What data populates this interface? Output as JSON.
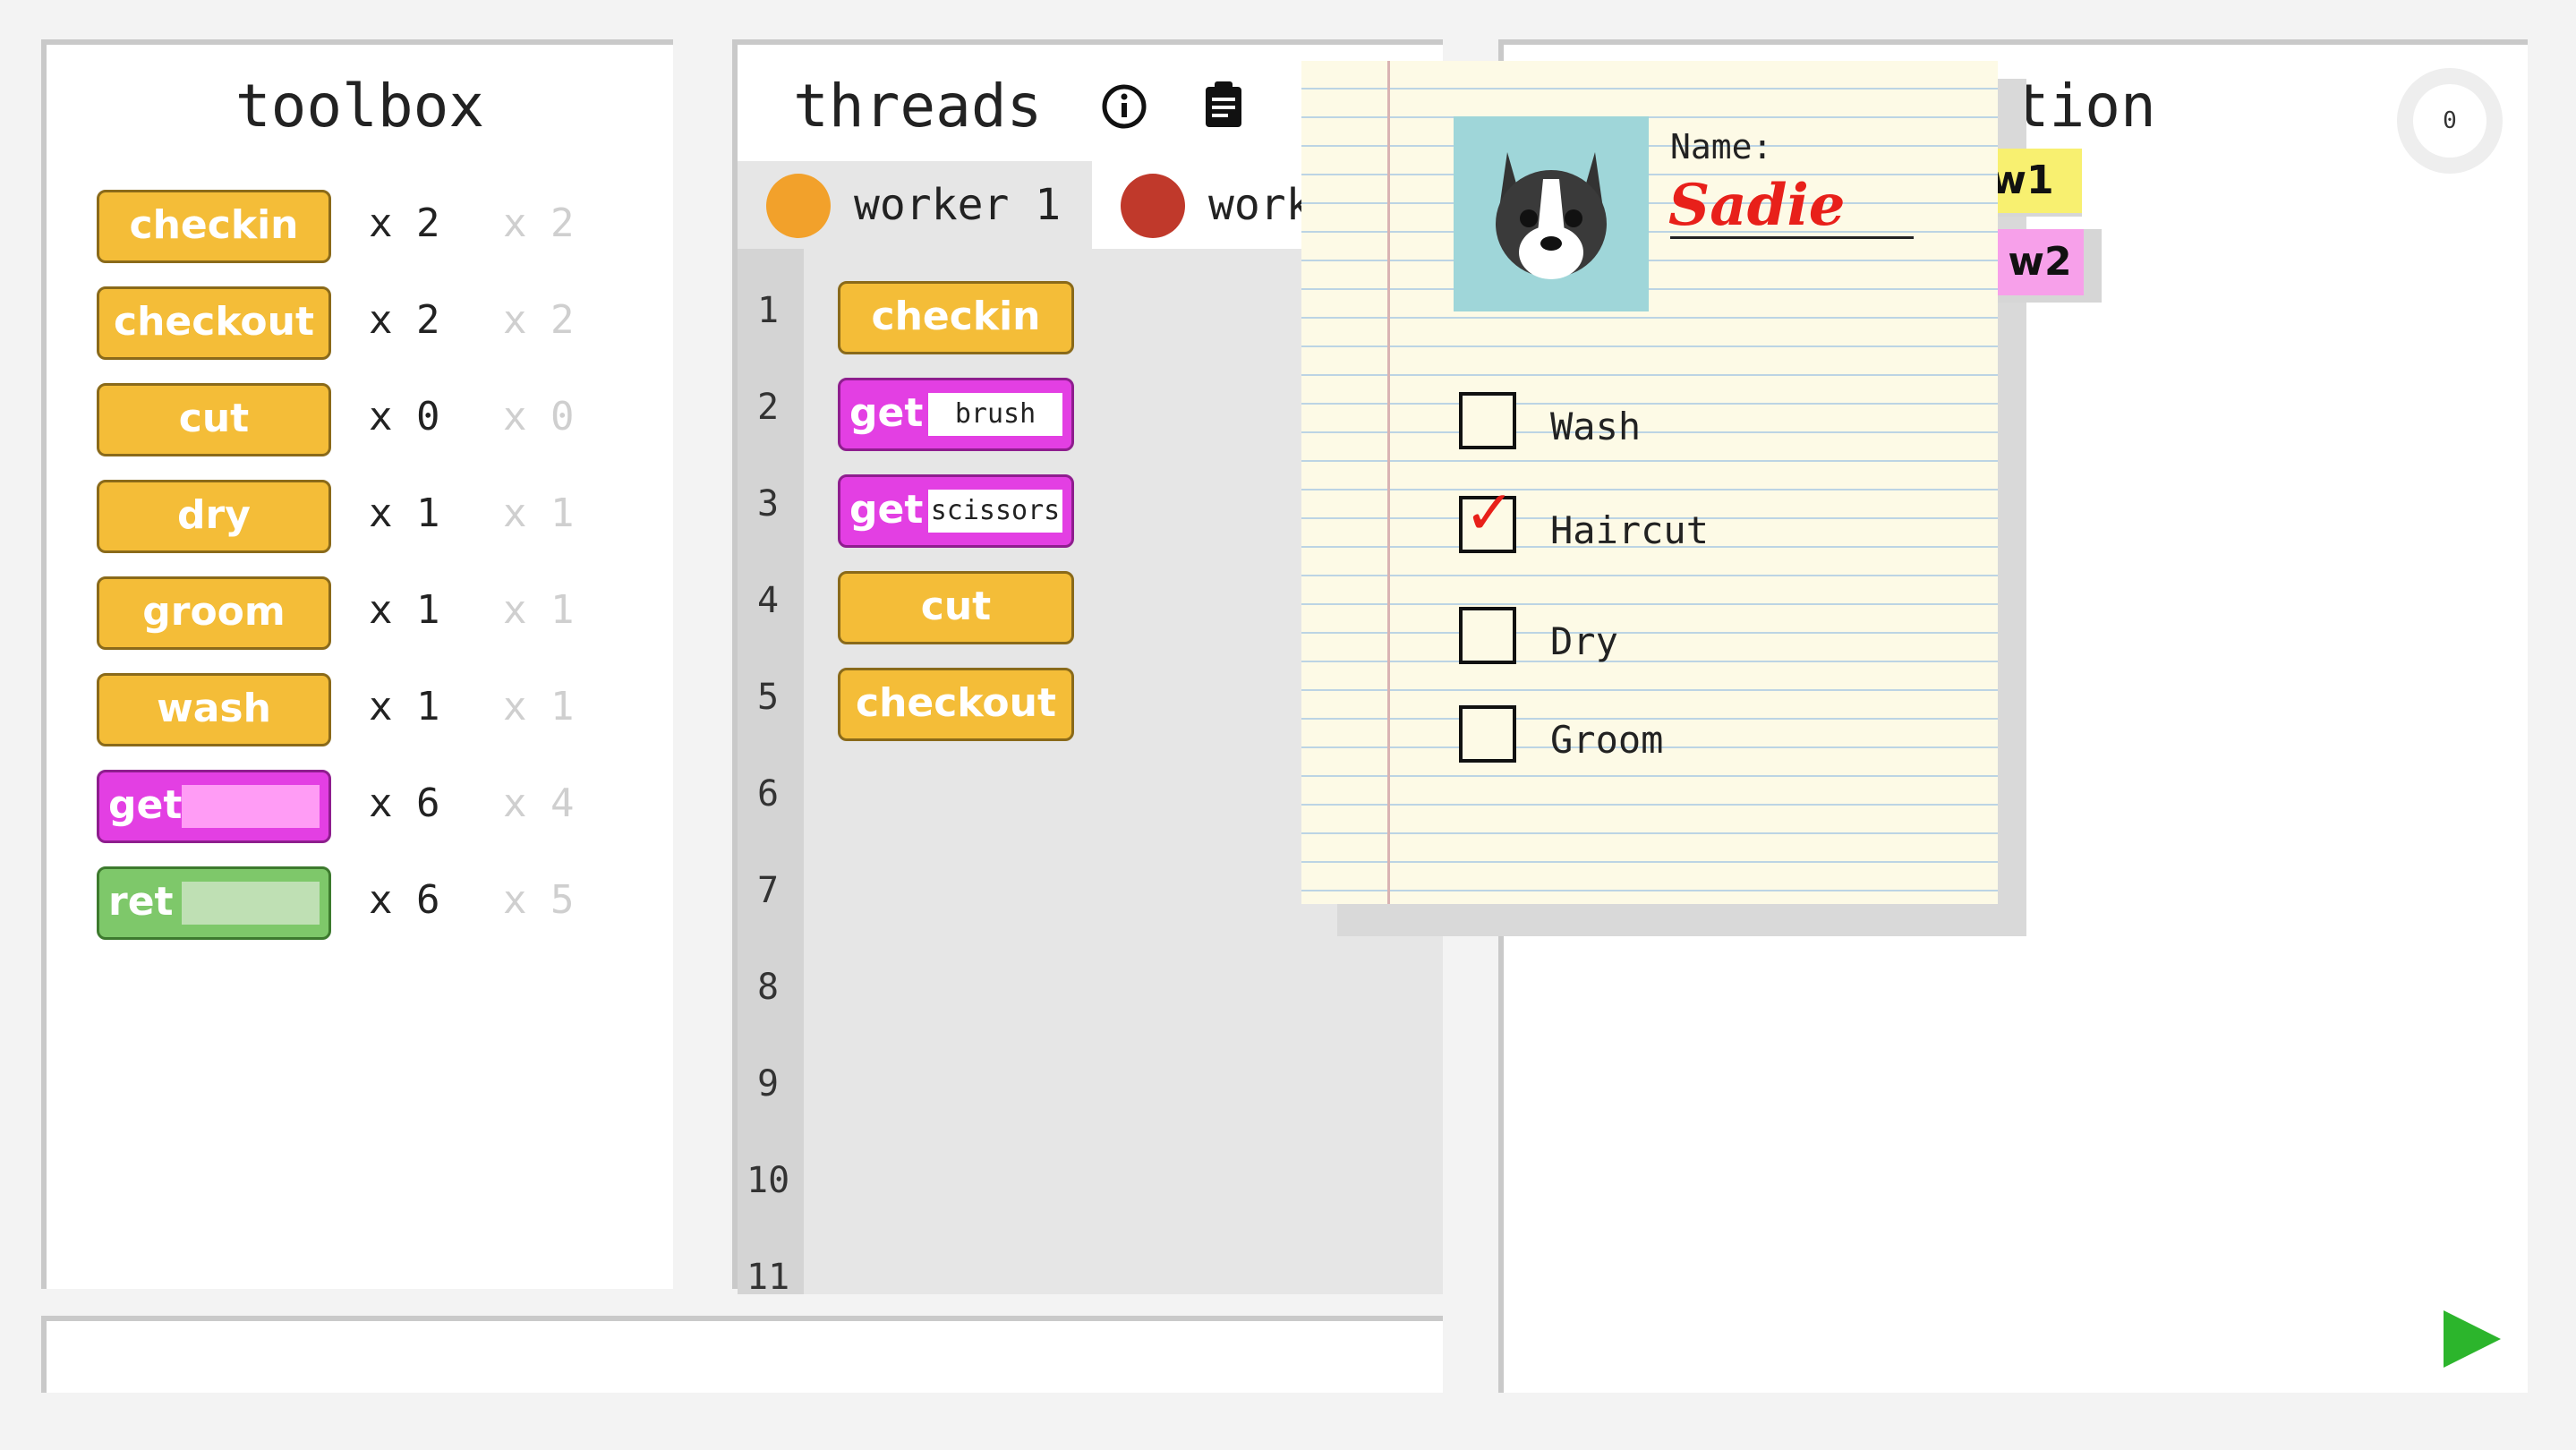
{
  "toolbox": {
    "title": "toolbox",
    "blocks": [
      {
        "label": "checkin",
        "count": "x 2",
        "max": "x 2"
      },
      {
        "label": "checkout",
        "count": "x 2",
        "max": "x 2"
      },
      {
        "label": "cut",
        "count": "x 0",
        "max": "x 0"
      },
      {
        "label": "dry",
        "count": "x 1",
        "max": "x 1"
      },
      {
        "label": "groom",
        "count": "x 1",
        "max": "x 1"
      },
      {
        "label": "wash",
        "count": "x 1",
        "max": "x 1"
      },
      {
        "label": "get",
        "count": "x 6",
        "max": "x 4"
      },
      {
        "label": "ret",
        "count": "x 6",
        "max": "x 5"
      }
    ]
  },
  "threads": {
    "title": "threads",
    "tabs": [
      {
        "label": "worker 1",
        "active": true
      },
      {
        "label": "worke",
        "active": false
      }
    ],
    "line_numbers": [
      "1",
      "2",
      "3",
      "4",
      "5",
      "6",
      "7",
      "8",
      "9",
      "10",
      "11"
    ],
    "code_blocks": [
      {
        "label": "checkin",
        "kind": "action"
      },
      {
        "label": "get",
        "kind": "get",
        "arg": "brush"
      },
      {
        "label": "get",
        "kind": "get",
        "arg": "scissors"
      },
      {
        "label": "cut",
        "kind": "action"
      },
      {
        "label": "checkout",
        "kind": "action"
      }
    ]
  },
  "visualization": {
    "title_fragment": "ation",
    "timer": "0",
    "tags": [
      "w1",
      "w2"
    ]
  },
  "note": {
    "name_label": "Name:",
    "name_value": "Sadie",
    "tasks": [
      {
        "label": "Wash",
        "checked": false
      },
      {
        "label": "Haircut",
        "checked": true
      },
      {
        "label": "Dry",
        "checked": false
      },
      {
        "label": "Groom",
        "checked": false
      }
    ],
    "check_mark": "✓"
  },
  "colors": {
    "action_block": "#f4bd38",
    "get_block": "#e33fe3",
    "ret_block": "#7ec86a",
    "play": "#2cb52c",
    "name_red": "#e8201a"
  }
}
